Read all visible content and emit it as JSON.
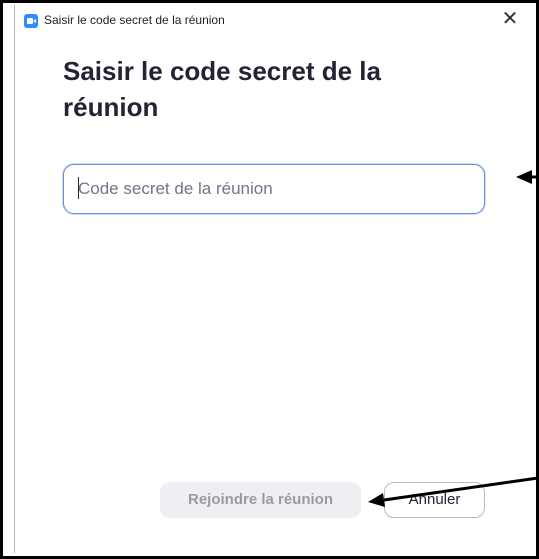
{
  "window": {
    "title": "Saisir le code secret de la réunion",
    "close_symbol": "✕",
    "app_icon": "zoom-camera-icon"
  },
  "dialog": {
    "heading": "Saisir le code secret de la réunion",
    "passcode_input": {
      "value": "",
      "placeholder": "Code secret de la réunion"
    },
    "join_button_label": "Rejoindre la réunion",
    "cancel_button_label": "Annuler"
  },
  "colors": {
    "accent": "#2d8cff",
    "input_border": "#6b8fc9",
    "disabled_button_bg": "#efeff3",
    "annotation_arrows": "#000000"
  }
}
